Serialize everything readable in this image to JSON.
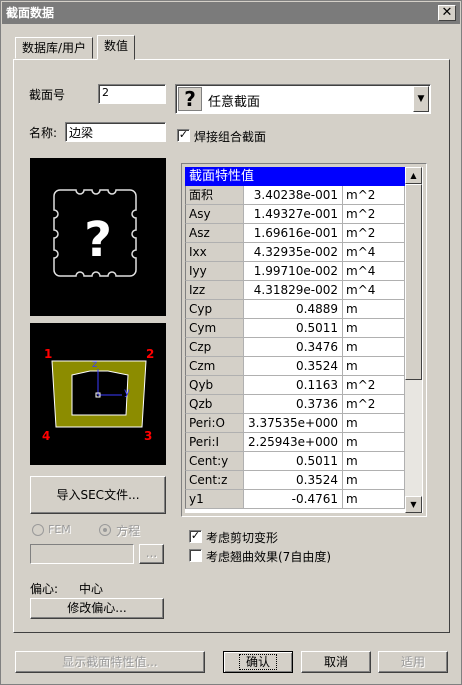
{
  "window": {
    "title": "截面数据",
    "close_glyph": "✕"
  },
  "tabs": [
    {
      "label": "数据库/用户"
    },
    {
      "label": "数值"
    }
  ],
  "section_no": {
    "label": "截面号",
    "value": "2"
  },
  "section_type": {
    "value": "任意截面",
    "icon": "question-mark-icon"
  },
  "name": {
    "label": "名称:",
    "value": "边梁"
  },
  "welded_combo": {
    "label": "焊接组合截面",
    "checked": true
  },
  "preview_shape": {
    "corner_labels": [
      "1",
      "2",
      "3",
      "4"
    ],
    "axis_labels": [
      "z",
      "y"
    ],
    "fill_color": "#8c8c00"
  },
  "import_button": {
    "label": "导入SEC文件..."
  },
  "method": {
    "options": [
      "FEM",
      "方程"
    ],
    "selected": "方程"
  },
  "browse_button": {
    "label": "..."
  },
  "offset": {
    "label": "偏心:",
    "value": "中心",
    "button": "修改偏心..."
  },
  "properties": {
    "header": "截面特性值",
    "rows": [
      {
        "name": "面积",
        "value": "3.40238e-001",
        "unit": "m^2"
      },
      {
        "name": "Asy",
        "value": "1.49327e-001",
        "unit": "m^2"
      },
      {
        "name": "Asz",
        "value": "1.69616e-001",
        "unit": "m^2"
      },
      {
        "name": "Ixx",
        "value": "4.32935e-002",
        "unit": "m^4"
      },
      {
        "name": "Iyy",
        "value": "1.99710e-002",
        "unit": "m^4"
      },
      {
        "name": "Izz",
        "value": "4.31829e-002",
        "unit": "m^4"
      },
      {
        "name": "Cyp",
        "value": "0.4889",
        "unit": "m"
      },
      {
        "name": "Cym",
        "value": "0.5011",
        "unit": "m"
      },
      {
        "name": "Czp",
        "value": "0.3476",
        "unit": "m"
      },
      {
        "name": "Czm",
        "value": "0.3524",
        "unit": "m"
      },
      {
        "name": "Qyb",
        "value": "0.1163",
        "unit": "m^2"
      },
      {
        "name": "Qzb",
        "value": "0.3736",
        "unit": "m^2"
      },
      {
        "name": "Peri:O",
        "value": "3.37535e+000",
        "unit": "m"
      },
      {
        "name": "Peri:I",
        "value": "2.25943e+000",
        "unit": "m"
      },
      {
        "name": "Cent:y",
        "value": "0.5011",
        "unit": "m"
      },
      {
        "name": "Cent:z",
        "value": "0.3524",
        "unit": "m"
      },
      {
        "name": "y1",
        "value": "-0.4761",
        "unit": "m"
      }
    ]
  },
  "options": {
    "shear_deform": {
      "label": "考虑剪切变形",
      "checked": true
    },
    "warping": {
      "label": "考虑翘曲效果(7自由度)",
      "checked": false
    }
  },
  "footer": {
    "show_props": "显示截面特性值...",
    "ok": "确认",
    "cancel": "取消",
    "apply": "适用"
  },
  "colors": {
    "grid_header": "#0000ff",
    "section_fill": "#8c8c00",
    "corner_label": "#ff0000"
  }
}
